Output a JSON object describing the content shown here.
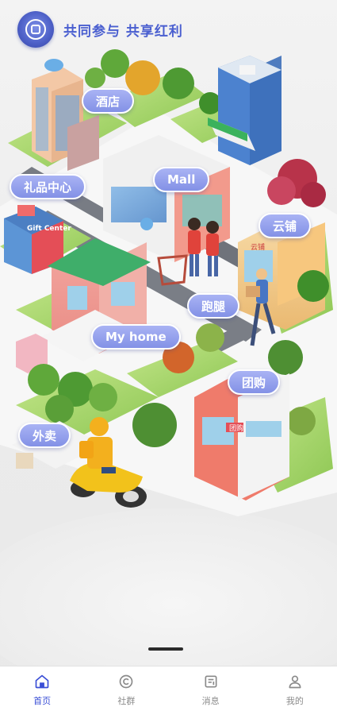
{
  "header": {
    "slogan": "共同参与  共享红利"
  },
  "chips": {
    "hotel": "酒店",
    "gift_center": "礼品中心",
    "mall": "Mall",
    "cloud_shop": "云铺",
    "errand": "跑腿",
    "my_home": "My home",
    "group_buy": "团购",
    "delivery": "外卖"
  },
  "signs": {
    "gift_center_sign": "Gift Center",
    "group_buy_sign": "团购",
    "cloud_shop_sign": "云铺"
  },
  "tabbar": {
    "items": [
      {
        "label": "首页",
        "icon": "home-icon",
        "active": true
      },
      {
        "label": "社群",
        "icon": "community-icon",
        "active": false
      },
      {
        "label": "消息",
        "icon": "message-icon",
        "active": false
      },
      {
        "label": "我的",
        "icon": "profile-icon",
        "active": false
      }
    ]
  },
  "colors": {
    "accent": "#3b4fd6",
    "chip": "#8f9bea",
    "slogan": "#4a5fd0",
    "inactive": "#8a8a8a"
  }
}
